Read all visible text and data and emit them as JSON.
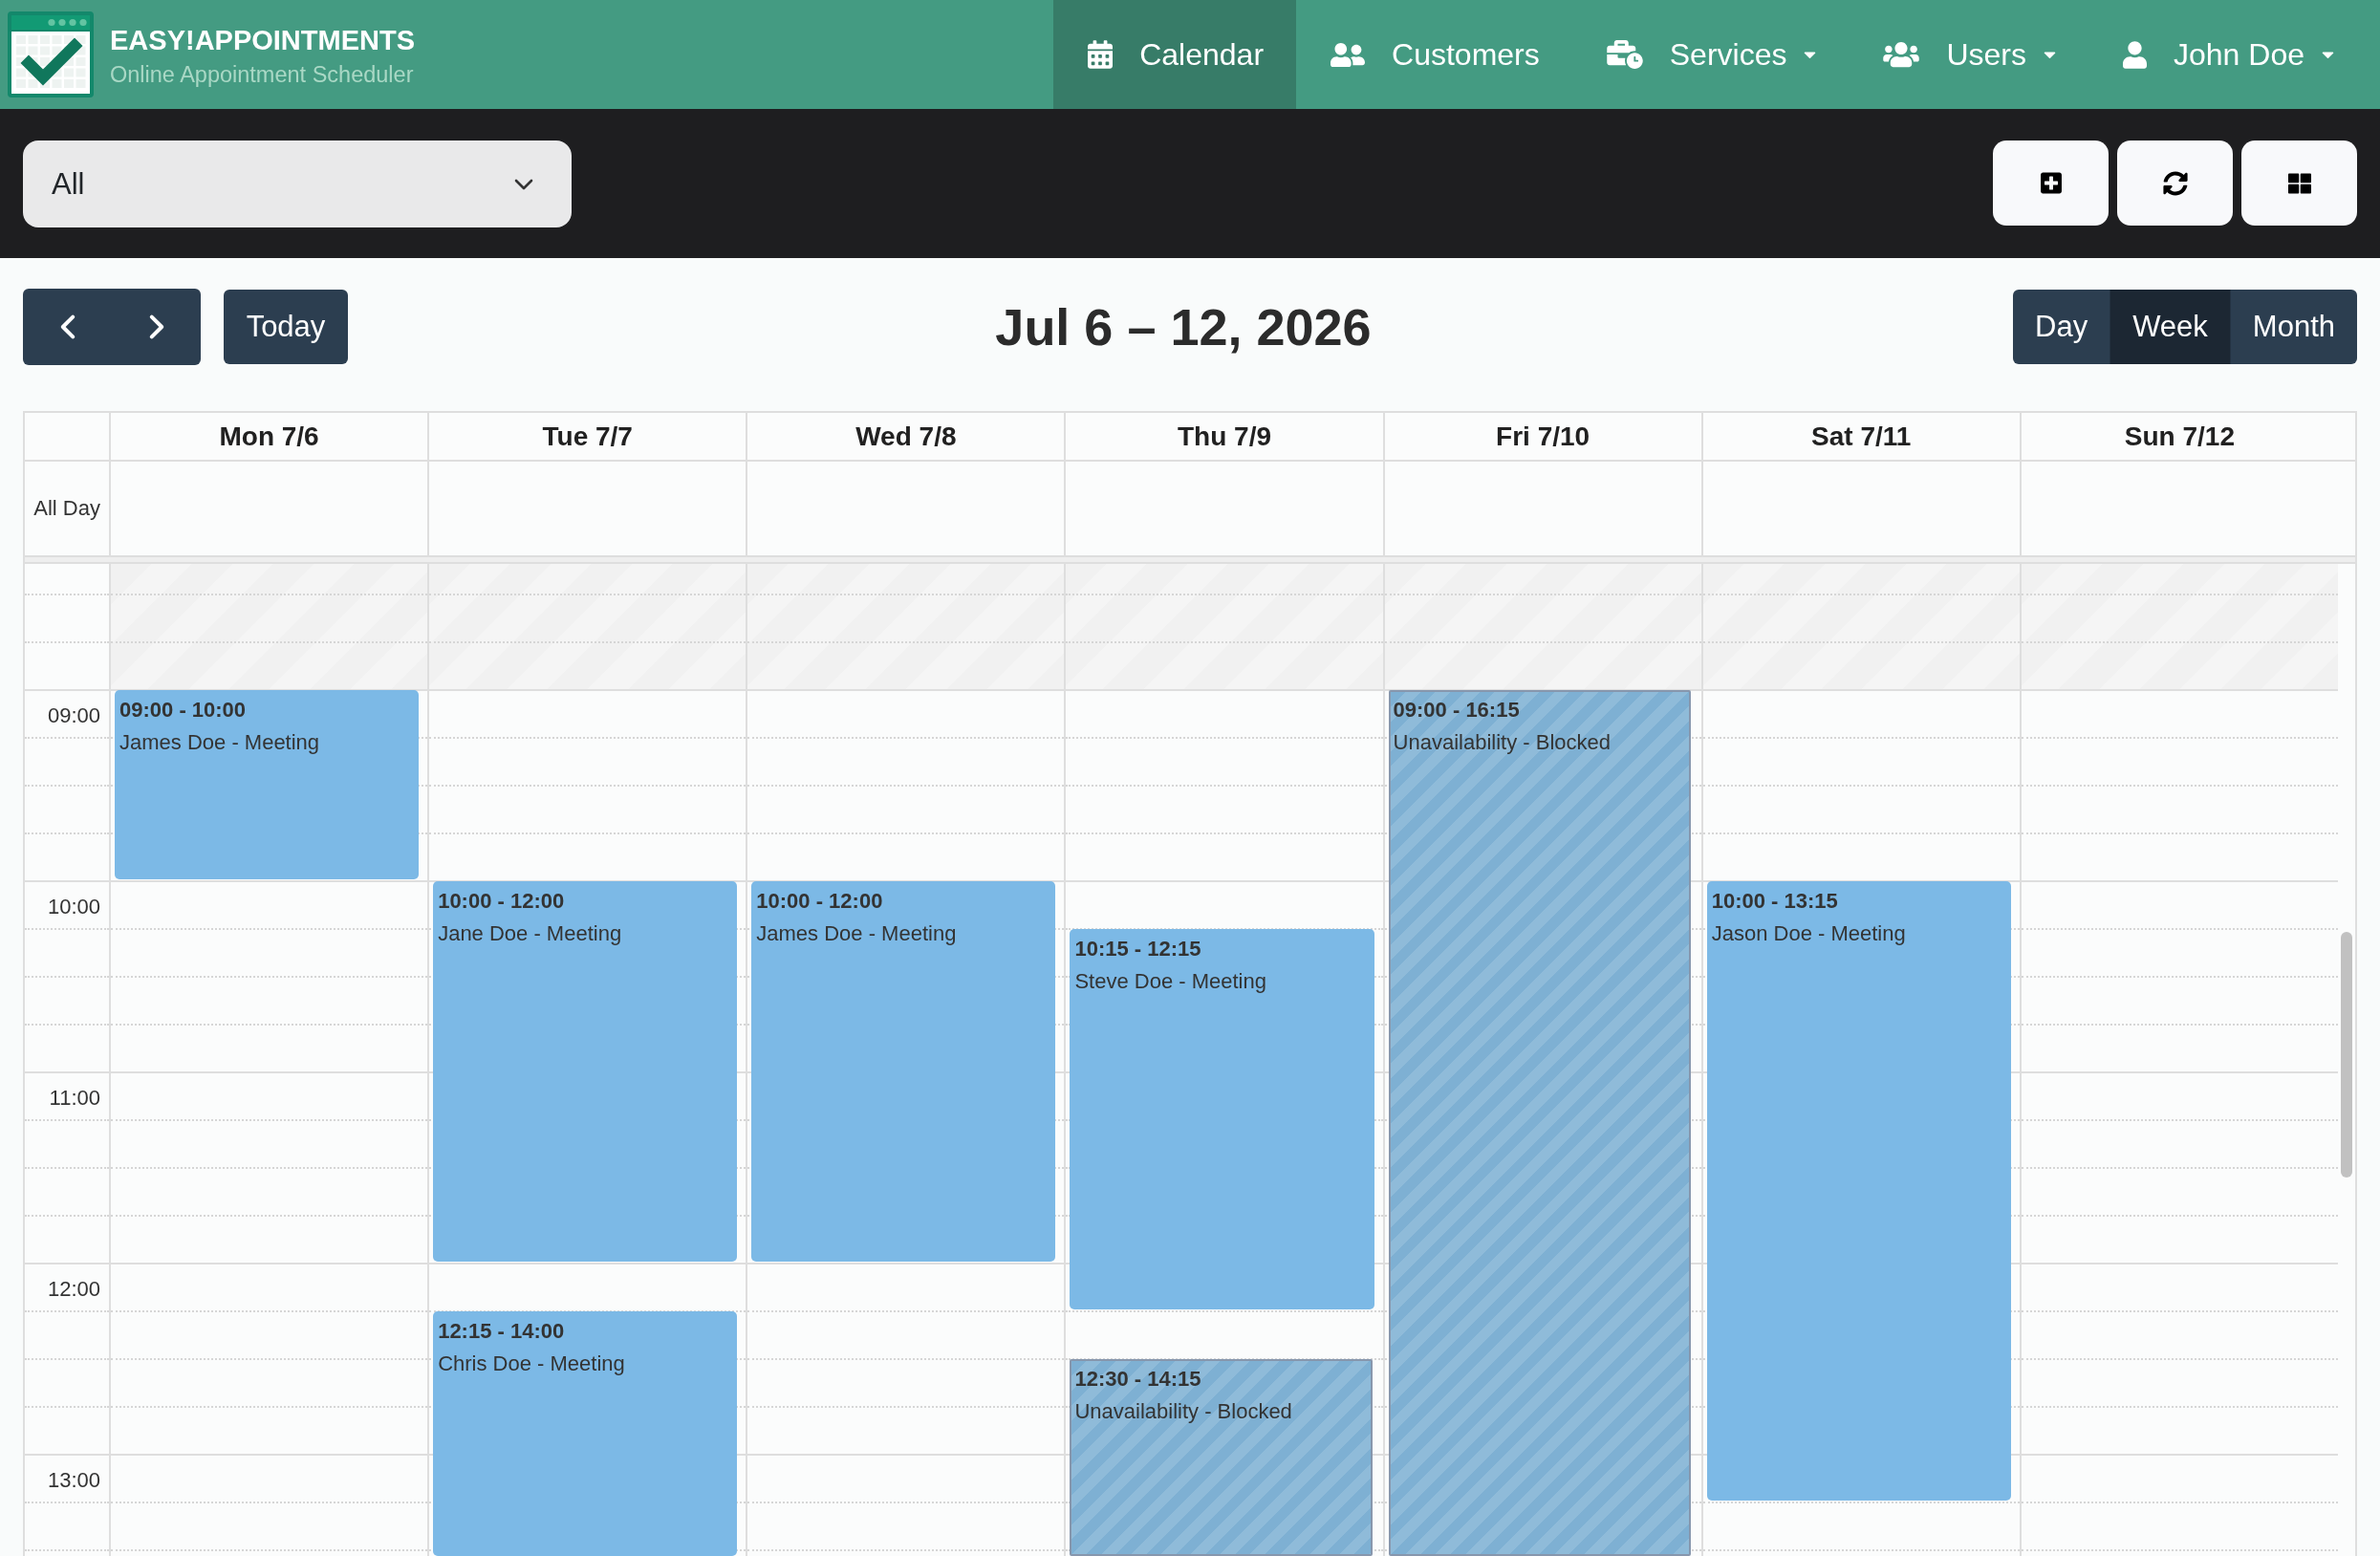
{
  "header": {
    "brand": {
      "title": "EASY!APPOINTMENTS",
      "subtitle": "Online Appointment Scheduler"
    },
    "nav": [
      {
        "kind": "calendar",
        "label": "Calendar",
        "selected": true,
        "menu": false
      },
      {
        "kind": "customers",
        "label": "Customers",
        "selected": false,
        "menu": false
      },
      {
        "kind": "services",
        "label": "Services",
        "selected": false,
        "menu": true
      },
      {
        "kind": "users",
        "label": "Users",
        "selected": false,
        "menu": true
      },
      {
        "kind": "account",
        "label": "John Doe",
        "selected": false,
        "menu": true
      }
    ]
  },
  "toolbar": {
    "filter": {
      "value": "All"
    },
    "actions": [
      {
        "kind": "add"
      },
      {
        "kind": "reload"
      },
      {
        "kind": "table"
      }
    ]
  },
  "calendar": {
    "today_button": "Today",
    "title": "Jul 6 – 12, 2026",
    "views": [
      {
        "label": "Day",
        "selected": false
      },
      {
        "label": "Week",
        "selected": true
      },
      {
        "label": "Month",
        "selected": false
      }
    ],
    "all_day_label": "All Day",
    "hours": [
      "09:00",
      "10:00",
      "11:00",
      "12:00",
      "13:00"
    ],
    "days": [
      {
        "label": "Mon 7/6",
        "events": [
          {
            "kind": "appointment",
            "time": "09:00 - 10:00",
            "title": "James Doe - Meeting"
          }
        ]
      },
      {
        "label": "Tue 7/7",
        "events": [
          {
            "kind": "appointment",
            "time": "10:00 - 12:00",
            "title": "Jane Doe - Meeting"
          },
          {
            "kind": "appointment",
            "time": "12:15 - 14:00",
            "title": "Chris Doe - Meeting"
          }
        ]
      },
      {
        "label": "Wed 7/8",
        "events": [
          {
            "kind": "appointment",
            "time": "10:00 - 12:00",
            "title": "James Doe - Meeting"
          }
        ]
      },
      {
        "label": "Thu 7/9",
        "events": [
          {
            "kind": "appointment",
            "time": "10:15 - 12:15",
            "title": "Steve Doe - Meeting"
          },
          {
            "kind": "unavailability",
            "time": "12:30 - 14:15",
            "title": "Unavailability - Blocked"
          }
        ]
      },
      {
        "label": "Fri 7/10",
        "events": [
          {
            "kind": "unavailability",
            "time": "09:00 - 16:15",
            "title": "Unavailability - Blocked"
          }
        ]
      },
      {
        "label": "Sat 7/11",
        "events": [
          {
            "kind": "appointment",
            "time": "10:00 - 13:15",
            "title": "Jason Doe - Meeting"
          }
        ]
      },
      {
        "label": "Sun 7/12"
      }
    ]
  }
}
